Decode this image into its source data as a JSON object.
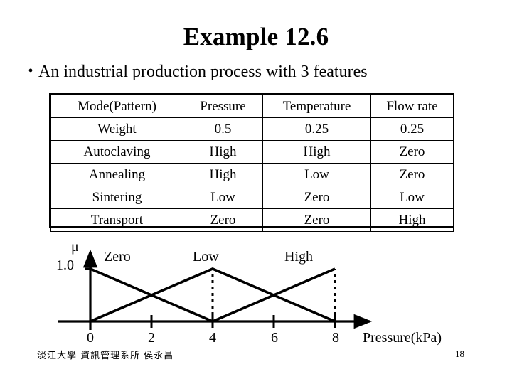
{
  "slide": {
    "title": "Example 12.6",
    "bullet_marker": "•",
    "bullet_text": "An industrial production process with 3 features",
    "footer": "淡江大學 資訊管理系所 侯永昌",
    "page_number": "18"
  },
  "table": {
    "headers": [
      "Mode(Pattern)",
      "Pressure",
      "Temperature",
      "Flow rate"
    ],
    "rows": [
      [
        "Weight",
        "0.5",
        "0.25",
        "0.25"
      ],
      [
        "Autoclaving",
        "High",
        "High",
        "Zero"
      ],
      [
        "Annealing",
        "High",
        "Low",
        "Zero"
      ],
      [
        "Sintering",
        "Low",
        "Zero",
        "Low"
      ],
      [
        "Transport",
        "Zero",
        "Zero",
        "High"
      ]
    ]
  },
  "chart_data": {
    "type": "line",
    "title": "",
    "xlabel": "Pressure(kPa)",
    "ylabel": "μ",
    "y_axis_top_label": "1.0",
    "xlim": [
      0,
      9.2
    ],
    "ylim": [
      0,
      1.0
    ],
    "xticks": [
      0,
      2,
      4,
      6,
      8
    ],
    "xtick_labels": [
      "0",
      "2",
      "4",
      "6",
      "8"
    ],
    "grid": false,
    "legend": "inline-labels",
    "series": [
      {
        "name": "Zero",
        "label_x": 1.0,
        "points": [
          [
            0,
            1.0
          ],
          [
            4,
            0
          ]
        ]
      },
      {
        "name": "Low",
        "label_x": 3.9,
        "points": [
          [
            0,
            0
          ],
          [
            4,
            1.0
          ],
          [
            8,
            0
          ]
        ]
      },
      {
        "name": "High",
        "label_x": 6.9,
        "points": [
          [
            4,
            0
          ],
          [
            8,
            1.0
          ]
        ]
      }
    ],
    "dashed_guides_x": [
      4,
      8
    ]
  }
}
